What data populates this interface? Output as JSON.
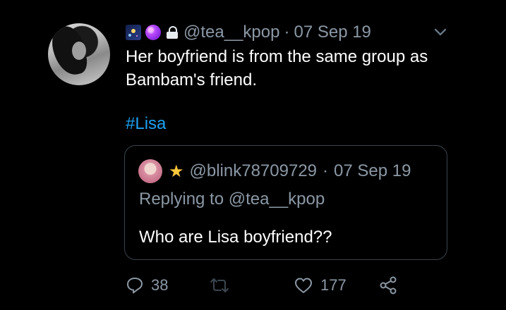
{
  "tweet": {
    "badges": [
      "sparkle-emoji",
      "purple-orb-emoji",
      "lock-icon"
    ],
    "handle": "@tea__kpop",
    "separator": "·",
    "date": "07 Sep 19",
    "text_lines": [
      "Her boyfriend is from the same group as",
      "Bambam's friend."
    ],
    "hashtag": "#Lisa"
  },
  "quoted": {
    "handle": "@blink78709729",
    "separator": "·",
    "date": "07 Sep 19",
    "replying_to": "Replying to @tea__kpop",
    "text": "Who are Lisa boyfriend??"
  },
  "actions": {
    "reply_count": "38",
    "retweet_count": "",
    "like_count": "177"
  },
  "colors": {
    "background": "#000000",
    "text": "#ffffff",
    "muted": "#8b98a5",
    "link": "#1da1f2",
    "border": "#38444d"
  }
}
